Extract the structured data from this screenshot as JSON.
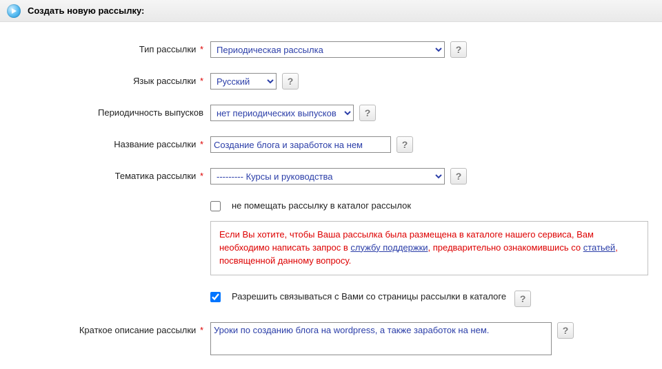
{
  "header": {
    "title": "Создать новую рассылку:"
  },
  "labels": {
    "type": "Тип рассылки",
    "lang": "Язык рассылки",
    "period": "Периодичность выпусков",
    "name": "Название рассылки",
    "topic": "Тематика рассылки",
    "no_catalog": "не помещать рассылку в каталог рассылок",
    "allow_contact": "Разрешить связываться с Вами со страницы рассылки в каталоге",
    "short_desc": "Краткое описание рассылки"
  },
  "values": {
    "type": "Периодическая рассылка",
    "lang": "Русский",
    "period": "нет периодических выпусков",
    "name": "Создание блога и заработок на нем",
    "topic": "--------- Курсы и руководства",
    "short_desc": "Уроки по созданию блога на wordpress, а также заработок на нем."
  },
  "notice": {
    "part1": "Если Вы хотите, чтобы Ваша рассылка была размещена в каталоге нашего сервиса, Вам необходимо написать запрос в ",
    "link1": "службу поддержки",
    "part2": ", предварительно ознакомившись со ",
    "link2": "статьей",
    "part3": ", посвященной данному вопросу."
  },
  "help": "?"
}
